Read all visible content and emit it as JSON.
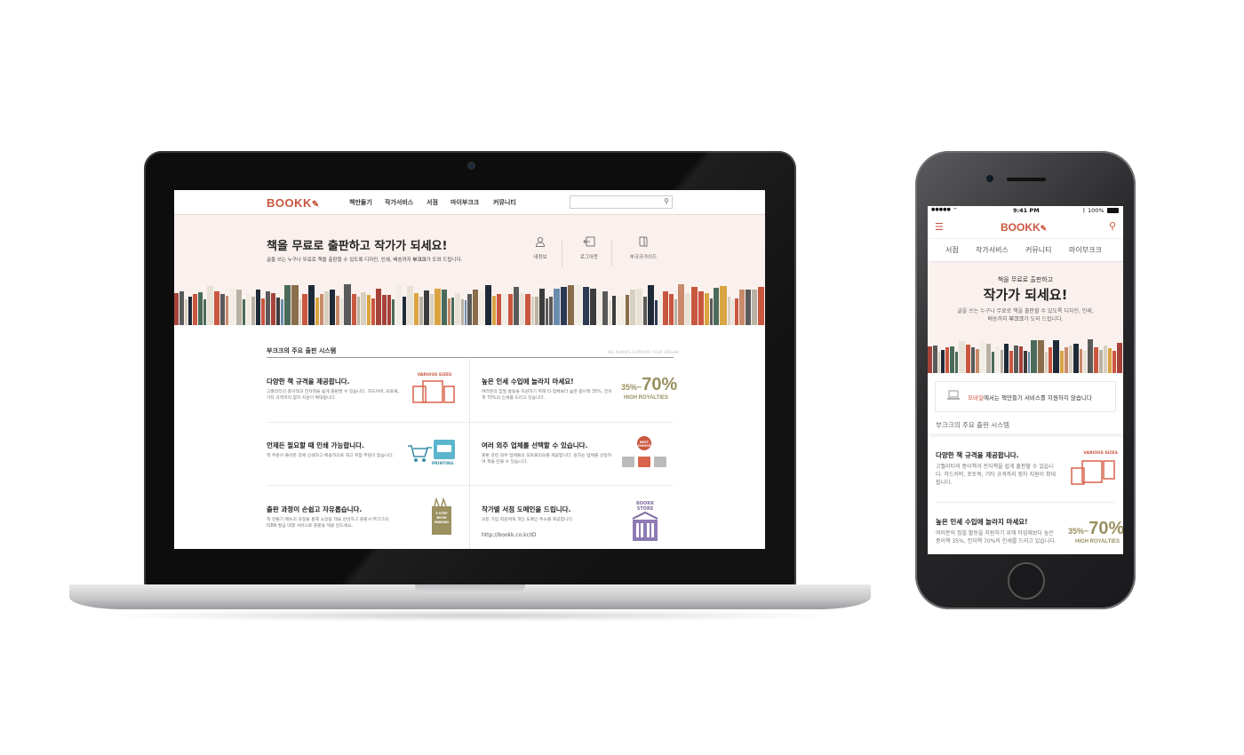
{
  "colors": {
    "brand": "#c9563f",
    "hero_bg": "#faf1ee",
    "royalty_green": "#9a9060"
  },
  "laptop": {
    "logo": "BOOKK",
    "nav": [
      "책만들기",
      "작가서비스",
      "서점",
      "마이부크크",
      "커뮤니티"
    ],
    "search_icon": "search-icon",
    "hero": {
      "title": "책을 무료로 출판하고 작가가 되세요!",
      "subtitle_pre": "글을 쓰는 누구나 무료로 책을 출판할 수 있도록 디자인, 인쇄, 배송까지 ",
      "subtitle_bold": "부크크",
      "subtitle_post": "가 도와 드립니다."
    },
    "util": [
      {
        "label": "내정보",
        "icon": "user-icon"
      },
      {
        "label": "로그아웃",
        "icon": "logout-icon"
      },
      {
        "label": "부크크가이드",
        "icon": "book-guide-icon"
      }
    ],
    "section": {
      "title": "부크크의 주요 출판 시스템",
      "tag": "WE ALWAYS SUPPORT YOUR DREAM"
    },
    "features": [
      {
        "title": "다양한 책 규격을 제공합니다.",
        "desc": "고퀄리티의 종이책과 전자책을 쉽게 출판할 수 있습니다. 하드커버, 포토북, 기타 규격까지 점차 지원이 확대됩니다.",
        "badge": "VARIOUS SIZES"
      },
      {
        "title": "높은 인세 수입에 놀라지 마세요!",
        "desc": "여러분의 집필 활동을 지원하기 위해 타 업체보다 높은 종이책 35%, 전자책 70%의 인세를 드리고 있습니다.",
        "badge_num_small": "35%~",
        "badge_num": "70%",
        "badge": "HIGH ROYALTIES"
      },
      {
        "title": "언제든 필요할 때 인쇄 가능합니다.",
        "desc": "책 주문이 들어온 후에 인쇄하고 배송하므로 재고 위험 부담이 없습니다.",
        "badge": "PRINTING"
      },
      {
        "title": "여러 외주 업체를 선택할 수 있습니다.",
        "desc": "출판 관련 외주 업체들의 포트폴리오를 제공합니다. 원하는 업체를 선정하여 책을 만들 수 있습니다.",
        "badge": "BEST CHOICE"
      },
      {
        "title": "출판 과정이 손쉽고 자유롭습니다.",
        "desc": "책 만들기 메뉴의 과정을 통해 소장용 책을 완성하고 출판사 부크크의 ISBN 발급 대행 서비스로 출판용 책을 만드세요.",
        "badge": "5 STEP BOOK MAKING"
      },
      {
        "title": "작가별 서점 도메인을 드립니다.",
        "desc": "모든 가입 회원에게 개인 도메인 주소를 제공합니다.",
        "url": "http://bookk.co.kr/ID",
        "badge": "BOOKK STORE"
      }
    ]
  },
  "phone": {
    "status": {
      "carrier": "●●●●●",
      "time": "9:41 PM",
      "battery": "100%"
    },
    "logo": "BOOKK",
    "menu_icon": "hamburger-menu-icon",
    "search_icon": "search-icon",
    "nav": [
      "서점",
      "작가서비스",
      "커뮤니티",
      "마이부크크"
    ],
    "hero": {
      "subtitle": "책을 무료로 출판하고",
      "title": "작가가 되세요!",
      "desc_pre": "글을 쓰는 누구나 무료로 책을 출판할 수 있도록 디자인, 인쇄, 배송까지 ",
      "desc_bold": "부크크",
      "desc_post": "가 도와 드립니다."
    },
    "notice": {
      "highlight": "모바일",
      "text": "에서는 책만들기 서비스를 지원하지 않습니다"
    },
    "section_title": "부크크의 주요 출판 시스템",
    "features": [
      {
        "title": "다양한 책 규격을 제공합니다.",
        "desc": "고퀄리티의 종이책과 전자책을 쉽게 출판할 수 있습니다. 하드커버, 포토북, 기타 규격까지 점차 지원이 확대됩니다.",
        "badge": "VARIOUS SIZES"
      },
      {
        "title": "높은 인세 수입에 놀라지 마세요!",
        "desc": "여러분의 집필 활동을 지원하기 위해 타업체보다 높은 종이책 35%, 전자책 70%의 인세를 드리고 있습니다.",
        "badge_num_small": "35%~",
        "badge_num": "70%",
        "badge": "HIGH ROYALTIES"
      }
    ]
  }
}
